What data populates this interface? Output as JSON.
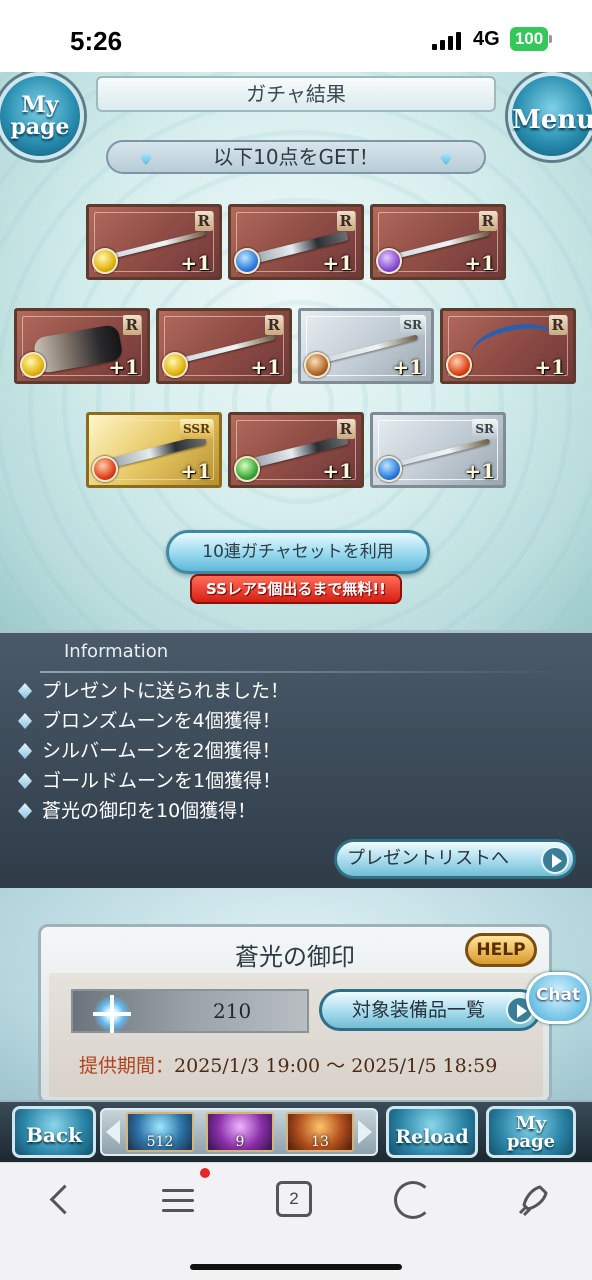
{
  "status_bar": {
    "time": "5:26",
    "network": "4G",
    "battery": "100"
  },
  "header": {
    "title": "ガチャ結果",
    "mypage_line1": "My",
    "mypage_line2": "page",
    "menu": "Menu"
  },
  "result_banner": "以下10点をGET！",
  "cards": [
    {
      "rarity": "R",
      "element": "light",
      "plus": "+1"
    },
    {
      "rarity": "R",
      "element": "water",
      "plus": "+1"
    },
    {
      "rarity": "R",
      "element": "dark",
      "plus": "+1"
    },
    {
      "rarity": "R",
      "element": "light",
      "plus": "+1"
    },
    {
      "rarity": "R",
      "element": "light",
      "plus": "+1"
    },
    {
      "rarity": "SR",
      "element": "earth",
      "plus": "+1"
    },
    {
      "rarity": "R",
      "element": "fire",
      "plus": "+1"
    },
    {
      "rarity": "SSR",
      "element": "fire",
      "plus": "+1"
    },
    {
      "rarity": "R",
      "element": "wind",
      "plus": "+1"
    },
    {
      "rarity": "SR",
      "element": "water",
      "plus": "+1"
    }
  ],
  "gacha_set_button": "10連ガチャセットを利用",
  "free_badge": "SSレア5個出るまで無料!!",
  "information": {
    "title": "Information",
    "items": [
      "プレゼントに送られました！",
      "ブロンズムーンを4個獲得！",
      "シルバームーンを2個獲得！",
      "ゴールドムーンを1個獲得！",
      "蒼光の御印を10個獲得！"
    ],
    "present_list_button": "プレゼントリストへ"
  },
  "seal": {
    "title": "蒼光の御印",
    "help": "HELP",
    "count": "210",
    "equipment_button": "対象装備品一覧",
    "period_label": "提供期間：",
    "period_value": "2025/1/3 19:00 〜 2025/1/5 18:59"
  },
  "chat": "Chat",
  "bottom_bar": {
    "back": "Back",
    "reload": "Reload",
    "mypage_line1": "My",
    "mypage_line2": "page",
    "items": [
      "512",
      "9",
      "13"
    ]
  },
  "browser": {
    "tabs_count": "2"
  },
  "colors": {
    "accent_blue": "#2a8fb1",
    "badge_red": "#d61f14",
    "info_bg": "#3a4856"
  }
}
